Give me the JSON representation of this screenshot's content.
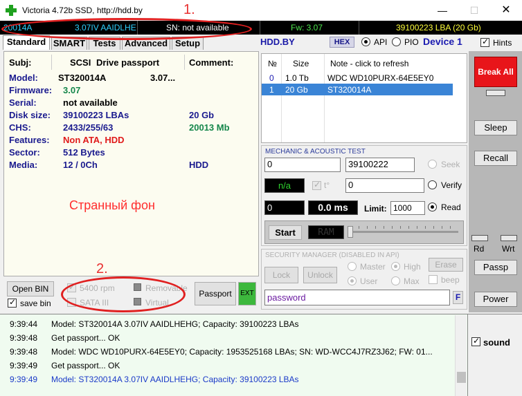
{
  "window": {
    "title": "Victoria 4.72b SSD, http://hdd.by",
    "min_glyph": "—",
    "max_glyph": "☐",
    "close_glyph": "✕"
  },
  "infobar": {
    "model": "20014A",
    "firmware": "3.07IV AAIDLHE",
    "serial": "SN: not available",
    "fw": "Fw: 3.07",
    "lba": "39100223 LBA (20 Gb)"
  },
  "tabs": [
    "Standard",
    "SMART",
    "Tests",
    "Advanced",
    "Setup"
  ],
  "toolbar": {
    "site": "HDD.BY",
    "hex": "HEX",
    "api_label": "API",
    "pio_label": "PIO",
    "device": "Device 1",
    "hints_label": "Hints"
  },
  "passport": {
    "header": {
      "subj": "Subj:",
      "scsi": "SCSI",
      "title": "Drive passport",
      "comment": "Comment:"
    },
    "rows": [
      {
        "key": "Model:",
        "value": "ST320014A",
        "extra": "3.07..."
      },
      {
        "key": "Firmware:",
        "value": "3.07"
      },
      {
        "key": "Serial:",
        "value": "not available"
      },
      {
        "key": "Disk size:",
        "value": "39100223 LBAs",
        "extra": "20 Gb"
      },
      {
        "key": "CHS:",
        "value": "2433/255/63",
        "extra": "20013 Mb"
      },
      {
        "key": "Features:",
        "value": "Non ATA, HDD"
      },
      {
        "key": "Sector:",
        "value": "512 Bytes"
      },
      {
        "key": "Media:",
        "value": "12 / 0Ch",
        "extra": "HDD"
      }
    ],
    "annotation_text": "Странный фон"
  },
  "bottom_left": {
    "open_bin": "Open BIN",
    "save_bin": "save bin",
    "rpm": "5400 rpm",
    "removable": "Removable",
    "sata": "SATA III",
    "virtual": "Virtual",
    "passport_btn": "Passport",
    "ext_btn": "EXT"
  },
  "drive_list": {
    "headers": {
      "num": "№",
      "size": "Size",
      "note": "Note - click to refresh"
    },
    "rows": [
      {
        "num": "0",
        "size": "1.0 Tb",
        "note": "WDC WD10PURX-64E5EY0"
      },
      {
        "num": "1",
        "size": "20 Gb",
        "note": "ST320014A"
      }
    ]
  },
  "mechanic": {
    "title": "MECHANIC  &  ACOUSTIC TEST",
    "start_lba": "0",
    "end_lba": "39100222",
    "seek_label": "Seek",
    "na": "n/a",
    "temp_label": "t°",
    "timer_value": "0",
    "verify_label": "Verify",
    "counter": "0",
    "ms": "0.0 ms",
    "limit_label": "Limit:",
    "limit_value": "1000",
    "read_label": "Read",
    "start_btn": "Start",
    "ram_display": "RAM"
  },
  "security": {
    "title": "SECURITY MANAGER (DISABLED IN API)",
    "lock": "Lock",
    "unlock": "Unlock",
    "master": "Master",
    "high": "High",
    "erase": "Erase",
    "user": "User",
    "max": "Max",
    "beep": "beep",
    "password_value": "password",
    "f_btn": "F"
  },
  "right": {
    "break_all": "Break All",
    "sleep": "Sleep",
    "recall": "Recall",
    "rd": "Rd",
    "wrt": "Wrt",
    "passp": "Passp",
    "power": "Power",
    "sound": "sound"
  },
  "log": [
    {
      "time": "9:39:44",
      "msg": "Model: ST320014A              3.07IV AAIDLHEHG; Capacity: 39100223 LBAs",
      "color": "black"
    },
    {
      "time": "9:39:48",
      "msg": "Get passport... OK",
      "color": "black"
    },
    {
      "time": "9:39:48",
      "msg": "Model: WDC WD10PURX-64E5EY0; Capacity: 1953525168 LBAs; SN: WD-WCC4J7RZ3J62; FW: 01...",
      "color": "black"
    },
    {
      "time": "9:39:49",
      "msg": "Get passport... OK",
      "color": "black"
    },
    {
      "time": "9:39:49",
      "msg": "Model: ST320014A              3.07IV AAIDLHEHG; Capacity: 39100223 LBAs",
      "color": "blue"
    }
  ],
  "annotations": {
    "one": "1.",
    "two": "2."
  },
  "colors": {
    "accent": "#1a1a8e",
    "break": "#e8151a",
    "select": "#3a84d6",
    "annotation": "#e02020"
  }
}
